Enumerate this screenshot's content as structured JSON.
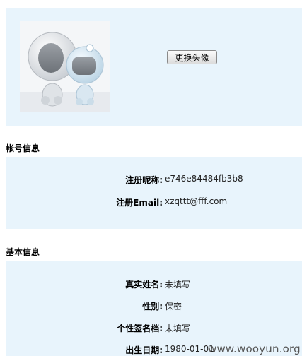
{
  "avatar_section": {
    "change_button_label": "更换头像"
  },
  "account_section": {
    "title": "帐号信息",
    "fields": [
      {
        "label": "注册昵称:",
        "value": "e746e84484fb3b8"
      },
      {
        "label": "注册Email:",
        "value": "xzqttt@fff.com"
      }
    ]
  },
  "basic_section": {
    "title": "基本信息",
    "fields": [
      {
        "label": "真实姓名:",
        "value": "未填写"
      },
      {
        "label": "性别:",
        "value": "保密"
      },
      {
        "label": "个性签名档:",
        "value": "未填写"
      },
      {
        "label": "出生日期:",
        "value": "1980-01-01"
      }
    ]
  },
  "watermark": "www.wooyun.org"
}
